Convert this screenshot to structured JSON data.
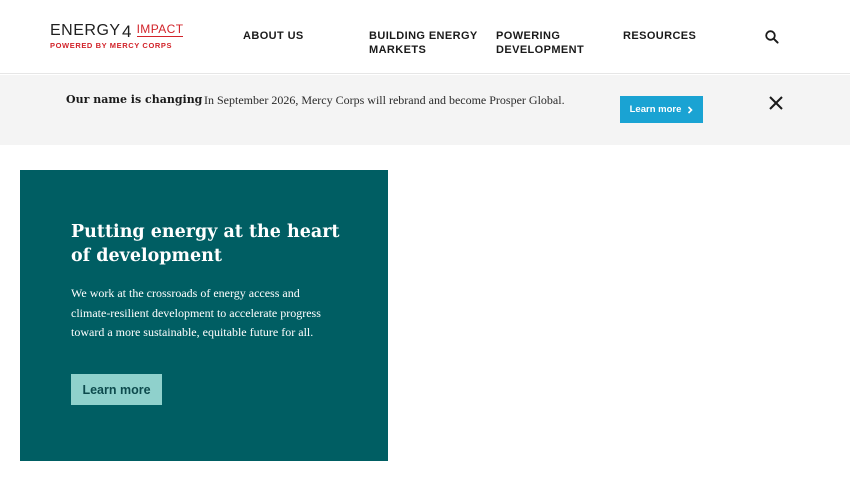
{
  "header": {
    "logo": {
      "brand_prefix": "ENERGY",
      "brand_digit": "4",
      "brand_suffix": "IMPACT",
      "tagline": "POWERED BY MERCY CORPS"
    },
    "nav": [
      {
        "label": "ABOUT US"
      },
      {
        "label": "BUILDING ENERGY MARKETS"
      },
      {
        "label": "POWERING DEVELOPMENT"
      },
      {
        "label": "RESOURCES"
      }
    ],
    "search_icon": "search-icon"
  },
  "banner": {
    "title": "Our name is changing",
    "text": "In September 2026, Mercy Corps will rebrand and become Prosper Global.",
    "button_label": "Learn more",
    "button_icon": "chevron-right-icon",
    "close_icon": "close-icon"
  },
  "hero": {
    "title": "Putting energy at the heart of development",
    "body": "We work at the crossroads of energy access and climate-resilient development to accelerate progress toward a more sustainable, equitable future for all.",
    "button_label": "Learn more"
  },
  "colors": {
    "hero_background": "#005e63",
    "hero_button": "#8fd1cc",
    "banner_button": "#1aa3d3",
    "brand_red": "#d2232a",
    "banner_background": "#f4f4f4"
  }
}
